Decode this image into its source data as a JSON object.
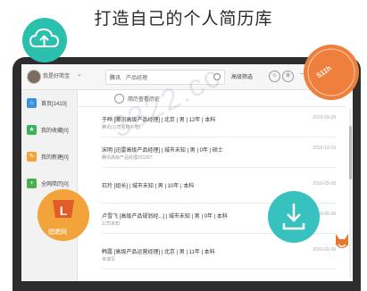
{
  "headline": "打造自己的个人简历库",
  "colors": {
    "teal": "#2bbfae",
    "orange": "#ef7f3c",
    "amber": "#f2a43a",
    "cyan": "#37c2bf",
    "blue_icon": "#3d8fe0",
    "green_icon": "#39b05a",
    "yellow_icon": "#f2a43a",
    "green2_icon": "#4cae4c"
  },
  "topbar": {
    "user_name": "我是好简宝",
    "search_scope": "腾讯",
    "search_value": "产品经理",
    "filter_label": "高级筛选"
  },
  "sidebar": {
    "items": [
      {
        "label": "首页[1410]",
        "icon": "home-icon"
      },
      {
        "label": "我的收藏[0]",
        "icon": "star-icon"
      },
      {
        "label": "我的新建[0]",
        "icon": "pencil-icon"
      },
      {
        "label": "全网简历[0]",
        "icon": "plus-icon"
      }
    ]
  },
  "history": {
    "label": "简历查看历史"
  },
  "rows": [
    {
      "title": "于晔 [腾讯高级产品经理]  |  北京  |  男  |  12年  |  本科",
      "sub": "腾讯(公司名称外包)",
      "date": "2016-09-28"
    },
    {
      "title": "宋明 [迅雷高级产品经理]  |  城市未知  |  男  |  0年  |  硕士",
      "sub": "腾讯高级产品经理201207",
      "date": "2016-10-19"
    },
    {
      "title": "石玲 [组长]  |  城市未知  |  男  |  10年  |  本科",
      "sub": "",
      "date": "2016-09-28"
    },
    {
      "title": "卢雪飞 [高级产品规划经...]  |  城市未知  |  男  |  0年  |  本科",
      "sub": "公司未知",
      "date": "2016-09-28"
    },
    {
      "title": "韩露 [高级产品运营经理]  |  北京  |  男  |  11年  |  本科",
      "sub": "未填写",
      "date": "2016-09-28"
    }
  ],
  "overlays": {
    "ttjl_text": "511h",
    "logo_text": "猎聘网",
    "watermark": "3322.cc"
  }
}
